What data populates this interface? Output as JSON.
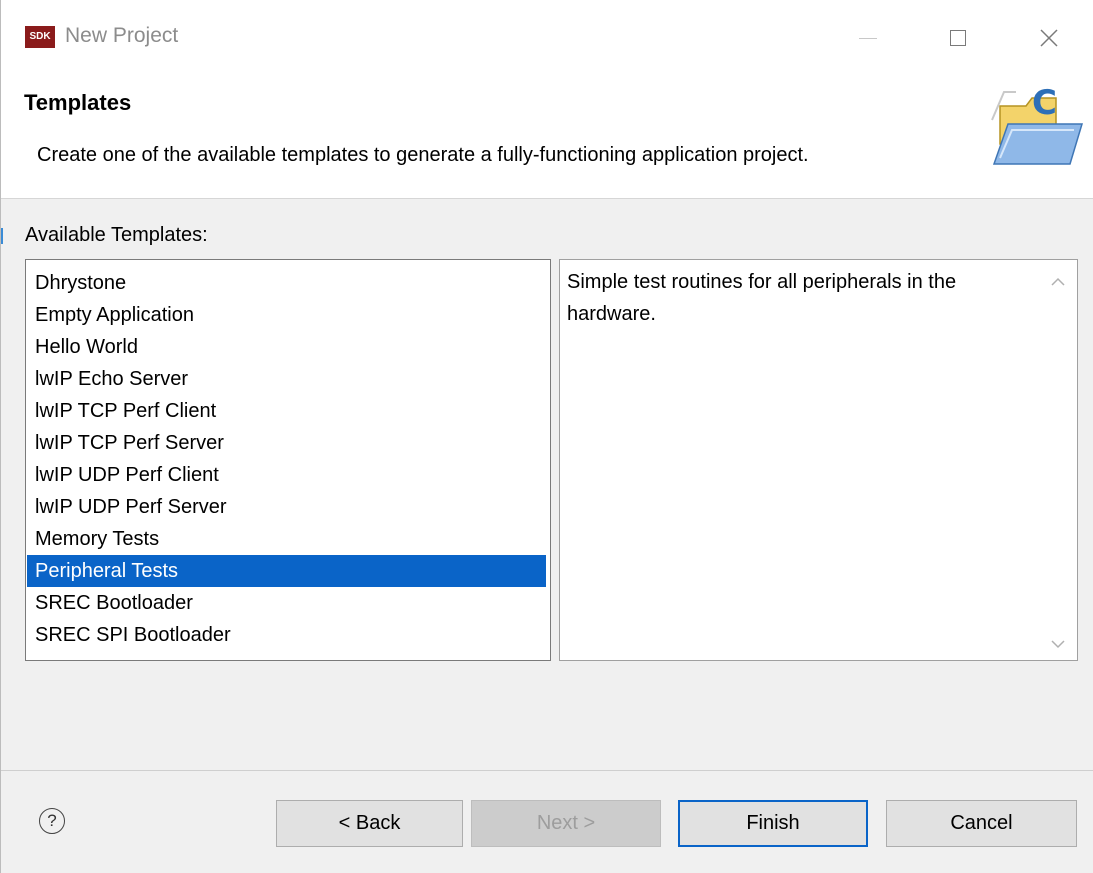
{
  "window": {
    "app_icon_text": "SDK",
    "title": "New Project"
  },
  "banner": {
    "title": "Templates",
    "description": "Create one of the available templates to generate a fully-functioning application project."
  },
  "templates": {
    "label": "Available Templates:",
    "items": [
      "Dhrystone",
      "Empty Application",
      "Hello World",
      "lwIP Echo Server",
      "lwIP TCP Perf Client",
      "lwIP TCP Perf Server",
      "lwIP UDP Perf Client",
      "lwIP UDP Perf Server",
      "Memory Tests",
      "Peripheral Tests",
      "SREC Bootloader",
      "SREC SPI Bootloader"
    ],
    "selected_index": 9,
    "selected_description": "Simple test routines for all peripherals in the hardware."
  },
  "buttons": {
    "help": "?",
    "back": "< Back",
    "next": "Next >",
    "finish": "Finish",
    "cancel": "Cancel"
  },
  "colors": {
    "selection": "#0a64c8",
    "app_icon_bg": "#8a1b1b"
  }
}
